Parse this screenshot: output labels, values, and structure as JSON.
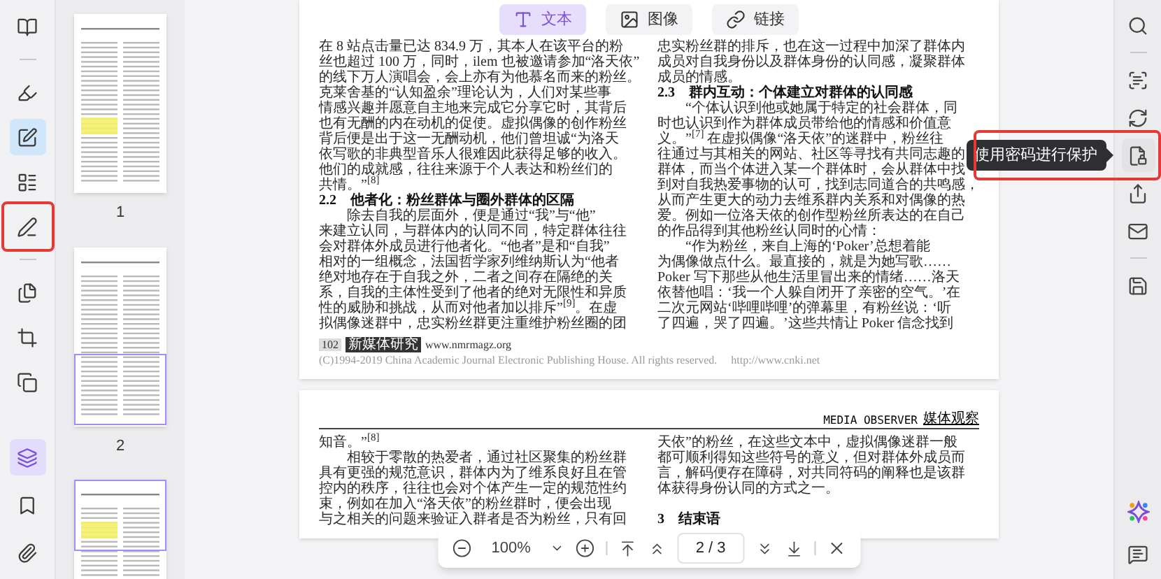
{
  "left_toolbar": {
    "top": [
      {
        "kind": "book",
        "selected": false,
        "annotated": false
      },
      {
        "kind": "divider"
      },
      {
        "kind": "highlighter",
        "selected": false,
        "annotated": false
      },
      {
        "kind": "edit",
        "selected": true,
        "annotated": false
      },
      {
        "kind": "form",
        "selected": false,
        "annotated": false
      },
      {
        "kind": "sign",
        "selected": false,
        "annotated": true
      },
      {
        "kind": "divider"
      },
      {
        "kind": "pages",
        "selected": false,
        "annotated": false
      },
      {
        "kind": "crop",
        "selected": false,
        "annotated": false
      },
      {
        "kind": "compress",
        "selected": false,
        "annotated": false
      }
    ],
    "bottom": [
      {
        "kind": "layers",
        "selected": true,
        "annotated": false
      },
      {
        "kind": "bookmark",
        "selected": false,
        "annotated": false
      },
      {
        "kind": "attachment",
        "selected": false,
        "annotated": false
      }
    ]
  },
  "thumbnails": [
    {
      "label": "1",
      "in_view": false,
      "highlighted": true
    },
    {
      "label": "2",
      "in_view": true,
      "highlighted": false
    },
    {
      "in_view": true,
      "highlighted": true
    }
  ],
  "top_tabs": [
    {
      "kind": "text",
      "label": "文本",
      "selected": true
    },
    {
      "kind": "image",
      "label": "图像",
      "selected": false
    },
    {
      "kind": "link",
      "label": "链接",
      "selected": false
    }
  ],
  "pages": [
    {
      "left": [
        {
          "kind": "text",
          "text": "在 8 站点击量已达 834.9 万，其本人在该平台的粉"
        },
        {
          "kind": "text",
          "text": "丝也超过 100 万，同时，ilem 也被邀请参加“洛天依”"
        },
        {
          "kind": "text",
          "text": "的线下万人演唱会，会上亦有为他慕名而来的粉丝。"
        },
        {
          "kind": "text",
          "text": "克莱舍基的“认知盈余”理论认为，人们对某些事"
        },
        {
          "kind": "text",
          "text": "情感兴趣并愿意自主地来完成它分享它时，其背后"
        },
        {
          "kind": "text",
          "text": "也有无酬的内在动机的促使。虚拟偶像的创作粉丝"
        },
        {
          "kind": "text",
          "text": "背后便是出于这一无酬动机，他们曾坦诚“为洛天"
        },
        {
          "kind": "text",
          "text": "依写歌的非典型音乐人很难因此获得足够的收入。"
        },
        {
          "kind": "text",
          "text": "他们的成就感，往往来源于个人表达和粉丝们的"
        },
        {
          "kind": "text",
          "text": "共情。”$^{[8]}$"
        },
        {
          "kind": "heading",
          "text": "2.2　他者化：粉丝群体与圈外群体的区隔"
        },
        {
          "kind": "text",
          "text": "　　除去自我的层面外，便是通过“我”与“他”"
        },
        {
          "kind": "text",
          "text": "来建立认同，与群体内的认同不同，特定群体往往"
        },
        {
          "kind": "text",
          "text": "会对群体外成员进行他者化。“他者”是和“自我”"
        },
        {
          "kind": "text",
          "text": "相对的一组概念，法国哲学家列维纳斯认为“他者"
        },
        {
          "kind": "text",
          "text": "绝对地存在于自我之外，二者之间存在隔绝的关"
        },
        {
          "kind": "text",
          "text": "系，自我的主体性受到了他者的绝对无限性和异质"
        },
        {
          "kind": "text",
          "text": "性的威胁和挑战，从而对他者加以排斥”$^{[9]}$。在虚"
        },
        {
          "kind": "text",
          "text": "拟偶像迷群中，忠实粉丝群更注重维护粉丝圈的团"
        }
      ],
      "right": [
        {
          "kind": "text",
          "text": "忠实粉丝群的排斥，也在这一过程中加深了群体内"
        },
        {
          "kind": "text",
          "text": "成员对自我身份以及群体身份的认同感，凝聚群体"
        },
        {
          "kind": "text",
          "text": "成员的情感。"
        },
        {
          "kind": "heading",
          "text": "2.3　群内互动：个体建立对群体的认同感"
        },
        {
          "kind": "text",
          "text": "　　“个体认识到他或她属于特定的社会群体，同"
        },
        {
          "kind": "text",
          "text": "时也认识到作为群体成员带给他的情感和价值意"
        },
        {
          "kind": "text",
          "text": "义。”$^{[7]}$ 在虚拟偶像“洛天依”的迷群中，粉丝往"
        },
        {
          "kind": "text",
          "text": "往通过与其相关的网站、社区等寻找有共同志趣的"
        },
        {
          "kind": "text",
          "text": "群体，而当个体进入某一个群体时，会从群体中找"
        },
        {
          "kind": "text",
          "text": "到对自我热爱事物的认可，找到志同道合的共鸣感，"
        },
        {
          "kind": "text",
          "text": "从而产生更大的动力去维系群内关系和对偶像的热"
        },
        {
          "kind": "text",
          "text": "爱。例如一位洛天依的创作型粉丝所表达的在自己"
        },
        {
          "kind": "text",
          "text": "的作品得到其他粉丝认同时的心情："
        },
        {
          "kind": "text",
          "text": "　　“作为粉丝，来自上海的‘Poker’总想着能"
        },
        {
          "kind": "text",
          "text": "为偶像做点什么。最直接的，就是为她写歌……"
        },
        {
          "kind": "text",
          "text": "Poker 写下那些从他生活里冒出来的情绪……洛天"
        },
        {
          "kind": "text",
          "text": "依替他唱：‘我一个人躲自闭开了亲密的空气。’在"
        },
        {
          "kind": "text",
          "text": "二次元网站‘哔哩哔哩’的弹幕里，有粉丝说：‘听"
        },
        {
          "kind": "text",
          "text": "了四遍，哭了四遍。’这些共情让 Poker 信念找到"
        }
      ],
      "footer": {
        "page_number": "102",
        "journal": "新媒体研究",
        "website": "www.nmrmagz.org",
        "copyright": "(C)1994-2019 China Academic Journal Electronic Publishing House. All rights reserved.",
        "copyright_link": "http://www.cnki.net"
      }
    },
    {
      "header": {
        "english": "MEDIA OBSERVER",
        "chinese": "媒体观察"
      },
      "left": [
        {
          "kind": "text",
          "text": "知音。”$^{[8]}$"
        },
        {
          "kind": "text",
          "text": "　　相较于零散的热爱者，通过社区聚集的粉丝群"
        },
        {
          "kind": "text",
          "text": "具有更强的规范意识，群体内为了维系良好且在管"
        },
        {
          "kind": "text",
          "text": "控内的秩序，往往也会对个体产生一定的规范性约"
        },
        {
          "kind": "text",
          "text": "束，例如在加入“洛天依”的粉丝群时，便会出现"
        },
        {
          "kind": "text",
          "text": "与之相关的问题来验证入群者是否为粉丝，只有回"
        }
      ],
      "right": [
        {
          "kind": "text",
          "text": "天依”的粉丝，在这些文本中，虚拟偶像迷群一般"
        },
        {
          "kind": "text",
          "text": "都可顺利得知这些符号的意义，但对群体外成员而"
        },
        {
          "kind": "text",
          "text": "言，解码便存在障碍，对共同符码的阐释也是该群"
        },
        {
          "kind": "text",
          "text": "体获得身份认同的方式之一。"
        },
        {
          "kind": "blank"
        },
        {
          "kind": "heading",
          "text": "3　结束语"
        }
      ]
    }
  ],
  "right_toolbar": {
    "top": [
      {
        "kind": "search"
      },
      {
        "kind": "divider"
      },
      {
        "kind": "ocr"
      },
      {
        "kind": "convert"
      },
      {
        "kind": "protect",
        "tooltip": "使用密码进行保护",
        "annotated": true
      },
      {
        "kind": "share"
      },
      {
        "kind": "mail"
      },
      {
        "kind": "divider"
      },
      {
        "kind": "save"
      }
    ],
    "bottom": [
      {
        "kind": "ai"
      },
      {
        "kind": "feedback"
      }
    ]
  },
  "bottom_bar": {
    "zoom": "100%",
    "page": "2 / 3"
  }
}
